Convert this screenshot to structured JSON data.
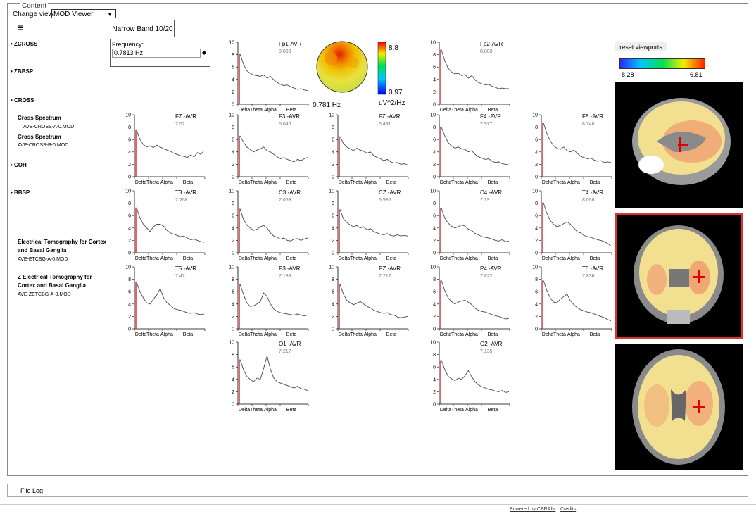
{
  "content_legend": "Content",
  "change_view": {
    "label": "Change view:",
    "selected": "MOD Viewer"
  },
  "narrow_band_tab": "Narrow Band 10/20",
  "frequency": {
    "label": "Frequency:",
    "value": "0.7813 Hz"
  },
  "sidebar": {
    "sections": [
      "ZCROSS",
      "ZBBSP",
      "CROSS",
      "COH",
      "BBSP"
    ],
    "cross_title_1": "Cross Spectrum",
    "cross_file_1": "AVE-CROSS-A-0.MOD",
    "cross_title_2": "Cross Spectrum",
    "cross_file_2": "AVE-CROSS-B-0.MOD",
    "et_title_1": "Electrical Tomography for Cortex",
    "et_title_1b": "and Basal Ganglia",
    "et_file_1": "AVE-ETCBG-A-0.MOD",
    "et_title_2": "Z Electrical Tomography for",
    "et_title_2b": "Cortex and Basal Ganglia",
    "et_file_2": "AVE-ZETCBG-A-0.MOD"
  },
  "topomap": {
    "freq_label": "0.781 Hz",
    "max": "8.8",
    "min": "0.97",
    "unit": "uV^2/Hz"
  },
  "reset_label": "reset viewports",
  "colorbar": {
    "min": "-8.28",
    "max": "6.81"
  },
  "file_log": "File Log",
  "footer": {
    "powered": "Powered by CBRAIN",
    "credits": "Credits"
  },
  "chart_data": {
    "type": "line",
    "band_labels": [
      "Delta",
      "Theta",
      "Alpha",
      "Beta"
    ],
    "ylim": [
      0,
      10
    ],
    "yticks": [
      0,
      2,
      4,
      6,
      8,
      10
    ],
    "plots": [
      {
        "channel": "Fp1-AVR",
        "peak": "8.099",
        "values": [
          8.1,
          6.5,
          5.4,
          5.0,
          4.7,
          4.6,
          4.5,
          4.7,
          4.2,
          4.5,
          3.9,
          3.5,
          3.2,
          3.0,
          3.1,
          2.8,
          2.6,
          2.4,
          2.5,
          2.3,
          2.2
        ]
      },
      {
        "channel": "Fp2-AVR",
        "peak": "8.803",
        "values": [
          8.8,
          7.0,
          5.8,
          5.2,
          4.9,
          5.0,
          4.6,
          4.8,
          4.2,
          4.6,
          3.9,
          3.5,
          3.3,
          3.1,
          3.2,
          2.9,
          2.7,
          2.5,
          2.6,
          2.5,
          2.5
        ]
      },
      {
        "channel": "F7 -AVR",
        "peak": "7.52",
        "values": [
          7.5,
          6.0,
          5.2,
          4.8,
          5.0,
          4.7,
          5.1,
          4.8,
          4.5,
          4.3,
          4.1,
          3.8,
          3.6,
          3.4,
          3.3,
          3.1,
          3.5,
          3.2,
          3.9,
          3.6,
          4.2
        ]
      },
      {
        "channel": "F3 -AVR",
        "peak": "6.646",
        "values": [
          6.6,
          5.6,
          4.8,
          4.4,
          4.0,
          4.3,
          4.5,
          4.8,
          4.2,
          4.0,
          3.6,
          3.2,
          2.9,
          3.1,
          2.8,
          2.6,
          2.4,
          2.8,
          2.6,
          2.9,
          3.1
        ]
      },
      {
        "channel": "FZ -AVR",
        "peak": "6.491",
        "values": [
          6.5,
          5.4,
          4.8,
          4.5,
          4.2,
          4.6,
          4.3,
          4.1,
          3.8,
          4.0,
          3.4,
          3.1,
          2.9,
          2.6,
          2.8,
          2.4,
          2.2,
          2.3,
          2.0,
          2.1,
          1.9
        ]
      },
      {
        "channel": "F4 -AVR",
        "peak": "7.977",
        "values": [
          8.0,
          6.6,
          5.5,
          5.0,
          4.6,
          4.8,
          4.5,
          4.4,
          4.0,
          4.2,
          3.6,
          3.2,
          3.0,
          2.8,
          2.9,
          2.5,
          2.3,
          2.4,
          2.1,
          2.0,
          1.9
        ]
      },
      {
        "channel": "F8 -AVR",
        "peak": "8.748",
        "values": [
          8.7,
          7.0,
          5.8,
          5.0,
          4.6,
          4.4,
          4.8,
          4.2,
          4.0,
          4.3,
          3.8,
          3.3,
          3.1,
          2.9,
          3.0,
          2.7,
          2.5,
          2.6,
          2.3,
          2.4,
          2.3
        ]
      },
      {
        "channel": "T3 -AVR",
        "peak": "7.268",
        "values": [
          7.3,
          5.6,
          4.6,
          4.0,
          3.4,
          4.2,
          4.6,
          4.6,
          4.3,
          3.6,
          3.2,
          3.0,
          2.8,
          2.6,
          2.7,
          2.4,
          2.1,
          2.2,
          2.0,
          1.8,
          1.7
        ]
      },
      {
        "channel": "C3 -AVR",
        "peak": "7.059",
        "values": [
          7.1,
          5.4,
          4.5,
          4.0,
          3.6,
          3.8,
          4.2,
          4.4,
          4.0,
          3.2,
          2.7,
          2.5,
          2.2,
          2.4,
          2.0,
          1.9,
          2.2,
          2.3,
          2.0,
          2.2,
          2.4
        ]
      },
      {
        "channel": "CZ -AVR",
        "peak": "6.986",
        "values": [
          7.0,
          5.5,
          4.9,
          4.5,
          4.2,
          4.4,
          4.0,
          4.2,
          3.7,
          3.9,
          3.4,
          3.2,
          3.0,
          2.9,
          3.1,
          2.8,
          2.7,
          2.9,
          2.7,
          2.8,
          2.7
        ]
      },
      {
        "channel": "C4 -AVR",
        "peak": "7.19",
        "values": [
          7.2,
          5.6,
          4.8,
          4.3,
          4.0,
          4.2,
          4.5,
          4.3,
          3.8,
          3.6,
          3.1,
          2.9,
          2.6,
          2.5,
          2.4,
          2.2,
          2.0,
          1.9,
          2.1,
          1.8,
          1.9
        ]
      },
      {
        "channel": "T4 -AVR",
        "peak": "8.058",
        "values": [
          8.1,
          6.4,
          5.2,
          4.6,
          4.2,
          4.4,
          4.7,
          5.0,
          4.6,
          4.0,
          3.4,
          3.2,
          2.8,
          2.6,
          2.5,
          2.3,
          2.1,
          2.0,
          1.8,
          1.5,
          1.1
        ]
      },
      {
        "channel": "T5 -AVR",
        "peak": "7.47",
        "values": [
          7.5,
          6.0,
          5.0,
          4.2,
          4.0,
          4.8,
          5.5,
          6.5,
          5.0,
          4.2,
          3.8,
          3.3,
          3.1,
          3.0,
          2.8,
          2.6,
          2.5,
          2.6,
          2.4,
          2.3,
          2.4
        ]
      },
      {
        "channel": "P3 -AVR",
        "peak": "7.189",
        "values": [
          7.2,
          5.6,
          4.2,
          3.6,
          3.7,
          4.0,
          4.4,
          5.8,
          5.2,
          4.0,
          3.2,
          2.8,
          2.6,
          2.5,
          2.4,
          2.3,
          2.2,
          2.4,
          2.2,
          2.1,
          2.2
        ]
      },
      {
        "channel": "PZ -AVR",
        "peak": "7.217",
        "values": [
          7.2,
          5.6,
          4.6,
          4.2,
          3.9,
          4.1,
          4.4,
          4.0,
          3.6,
          3.4,
          3.0,
          2.8,
          2.6,
          2.5,
          2.6,
          2.3,
          2.2,
          1.9,
          1.8,
          1.9,
          2.0
        ]
      },
      {
        "channel": "P4 -AVR",
        "peak": "7.822",
        "values": [
          7.8,
          6.2,
          5.0,
          4.4,
          4.0,
          4.3,
          4.5,
          4.6,
          4.3,
          3.9,
          3.3,
          3.0,
          2.8,
          2.7,
          2.5,
          2.3,
          2.1,
          2.0,
          1.8,
          1.6,
          1.7
        ]
      },
      {
        "channel": "T6 -AVR",
        "peak": "7.836",
        "values": [
          7.8,
          6.2,
          5.0,
          4.3,
          4.2,
          4.8,
          5.2,
          5.6,
          4.5,
          3.9,
          3.4,
          3.1,
          2.9,
          2.7,
          2.6,
          2.4,
          2.2,
          2.0,
          1.8,
          1.5,
          1.3
        ]
      },
      {
        "channel": "O1 -AVR",
        "peak": "7.217",
        "values": [
          7.2,
          5.6,
          4.5,
          4.0,
          3.6,
          4.2,
          4.0,
          5.8,
          7.8,
          5.6,
          4.2,
          3.6,
          3.4,
          3.2,
          3.0,
          2.8,
          2.6,
          2.9,
          2.5,
          2.4,
          2.2
        ]
      },
      {
        "channel": "O2 -AVR",
        "peak": "7.135",
        "values": [
          7.1,
          5.6,
          4.5,
          4.1,
          3.8,
          4.2,
          4.0,
          4.6,
          5.4,
          4.4,
          3.6,
          3.1,
          2.8,
          2.6,
          2.4,
          2.3,
          2.1,
          2.0,
          2.2,
          1.9,
          2.0
        ]
      }
    ]
  }
}
